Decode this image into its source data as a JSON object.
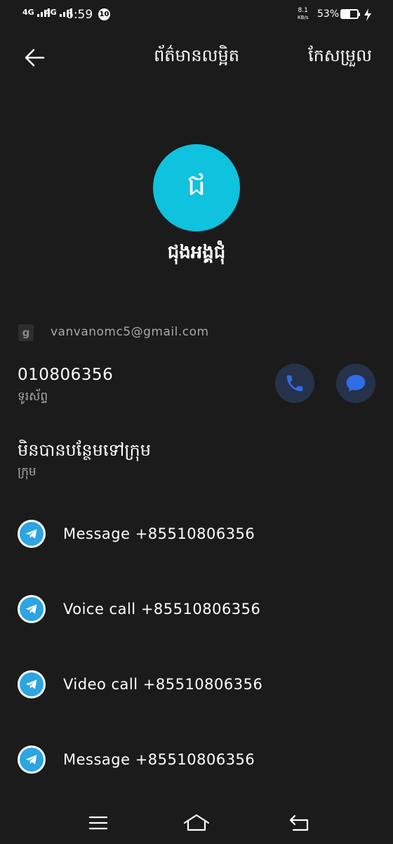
{
  "status_bar": {
    "network_1": "4G",
    "network_2": "4G",
    "time": "6:59",
    "notification_count": "10",
    "speed_value": "8.1",
    "speed_unit": "KB/s",
    "battery": "53%"
  },
  "header": {
    "title": "ព័ត៌មានលម្អិត",
    "edit_label": "កែសម្រួល"
  },
  "contact": {
    "avatar_initial": "ជ",
    "avatar_color": "#0fc2de",
    "name": "ជុងអង្គជុំ",
    "email": "vanvanomc5@gmail.com",
    "email_account_icon": "g",
    "phone_number": "010806356",
    "phone_type": "ទូរស័ព្ទ"
  },
  "group": {
    "title": "មិនបានបន្ថែមទៅក្រុម",
    "subtitle": "ក្រុម"
  },
  "telegram_actions": [
    {
      "label": "Message +85510806356"
    },
    {
      "label": "Voice call +85510806356"
    },
    {
      "label": "Video call +85510806356"
    },
    {
      "label": "Message +85510806356"
    }
  ],
  "icons": {
    "back": "arrow-left-icon",
    "call": "phone-icon",
    "message": "chat-bubble-icon",
    "telegram": "telegram-icon",
    "menu": "menu-icon",
    "home": "home-icon",
    "return": "return-icon"
  },
  "colors": {
    "background": "#1b1b1b",
    "accent_blue": "#2f6ce5",
    "telegram_blue": "#2ca5e0",
    "button_bg": "#25324a"
  }
}
